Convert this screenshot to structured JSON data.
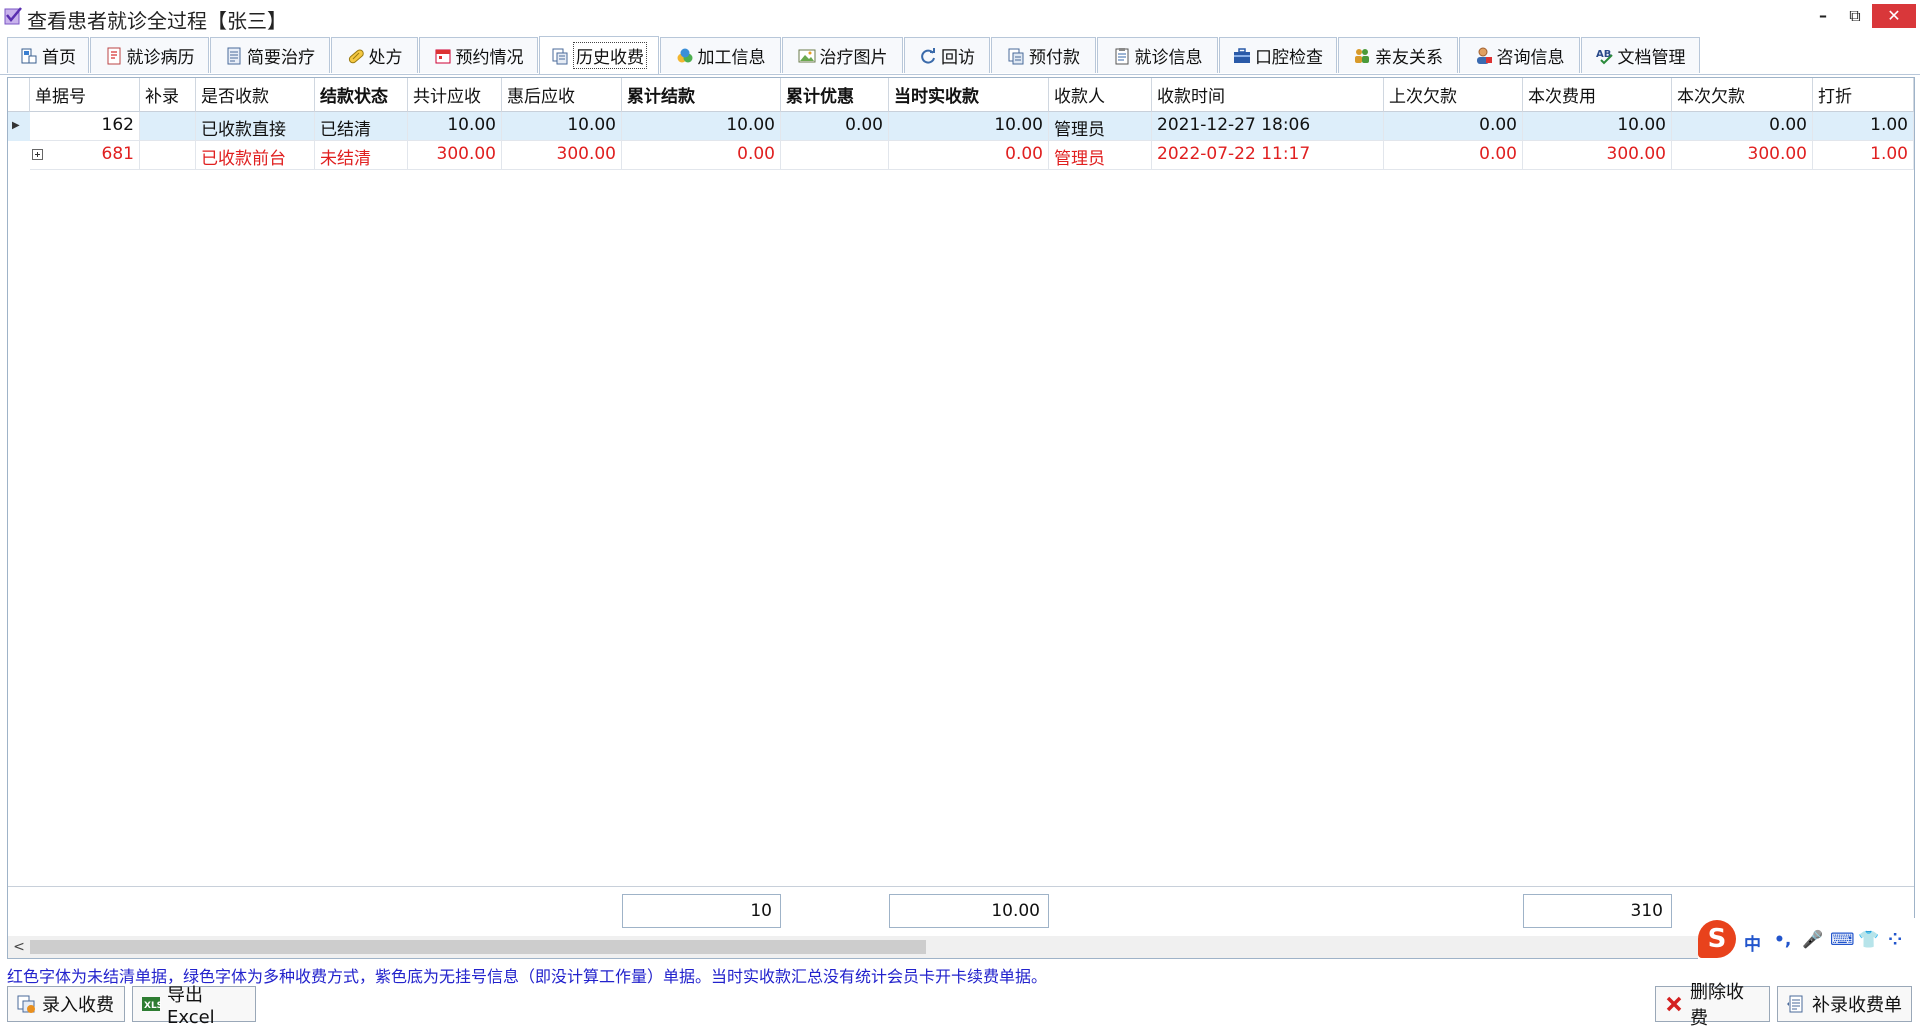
{
  "window": {
    "title": "查看患者就诊全过程【张三】",
    "controls": {
      "minimize": "–",
      "restore": "⧉",
      "close": "✕"
    }
  },
  "tabs": [
    {
      "label": "首页",
      "icon": "home-icon"
    },
    {
      "label": "就诊病历",
      "icon": "medical-record-icon"
    },
    {
      "label": "简要治疗",
      "icon": "document-icon"
    },
    {
      "label": "处方",
      "icon": "pill-icon"
    },
    {
      "label": "预约情况",
      "icon": "calendar-icon"
    },
    {
      "label": "历史收费",
      "icon": "receipt-icon",
      "active": true
    },
    {
      "label": "加工信息",
      "icon": "shapes-icon"
    },
    {
      "label": "治疗图片",
      "icon": "image-icon"
    },
    {
      "label": "回访",
      "icon": "refresh-icon"
    },
    {
      "label": "预付款",
      "icon": "prepay-icon"
    },
    {
      "label": "就诊信息",
      "icon": "clipboard-icon"
    },
    {
      "label": "口腔检查",
      "icon": "briefcase-icon"
    },
    {
      "label": "亲友关系",
      "icon": "group-icon"
    },
    {
      "label": "咨询信息",
      "icon": "user-consult-icon"
    },
    {
      "label": "文档管理",
      "icon": "spellcheck-icon"
    }
  ],
  "grid": {
    "columns": [
      "单据号",
      "补录",
      "是否收款",
      "结款状态",
      "共计应收",
      "惠后应收",
      "累计结款",
      "累计优惠",
      "当时实收款",
      "收款人",
      "收款时间",
      "上次欠款",
      "本次费用",
      "本次欠款",
      "打折"
    ],
    "rows": [
      {
        "highlight": "selected",
        "red": false,
        "cells": [
          "162",
          "",
          "已收款直接",
          "已结清",
          "10.00",
          "10.00",
          "10.00",
          "0.00",
          "10.00",
          "管理员",
          "2021-12-27 18:06",
          "0.00",
          "10.00",
          "0.00",
          "1.00"
        ]
      },
      {
        "highlight": "none",
        "red": true,
        "cells": [
          "681",
          "",
          "已收款前台",
          "未结清",
          "300.00",
          "300.00",
          "0.00",
          "",
          "0.00",
          "管理员",
          "2022-07-22 11:17",
          "0.00",
          "300.00",
          "300.00",
          "1.00"
        ]
      }
    ],
    "summary": {
      "total_receivable": "10",
      "actual_received": "10.00",
      "current_fee": "310"
    }
  },
  "ime": {
    "lang": "中",
    "punct": "•,",
    "mic": "🎤",
    "keyboard": "⌨",
    "skin": "👕",
    "menu": "⁘"
  },
  "hint": "红色字体为未结清单据，绿色字体为多种收费方式，紫色底为无挂号信息（即没计算工作量）单据。当时实收款汇总没有统计会员卡开卡续费单据。",
  "buttons": {
    "enter_payment": "录入收费",
    "export_excel": "导出Excel",
    "delete_payment": "删除收费",
    "supplement_bill": "补录收费单"
  },
  "colors": {
    "red_text": "#e02020",
    "selected_row": "#ddeefa",
    "hint_text": "#2222cc",
    "close_button": "#d9373a"
  }
}
